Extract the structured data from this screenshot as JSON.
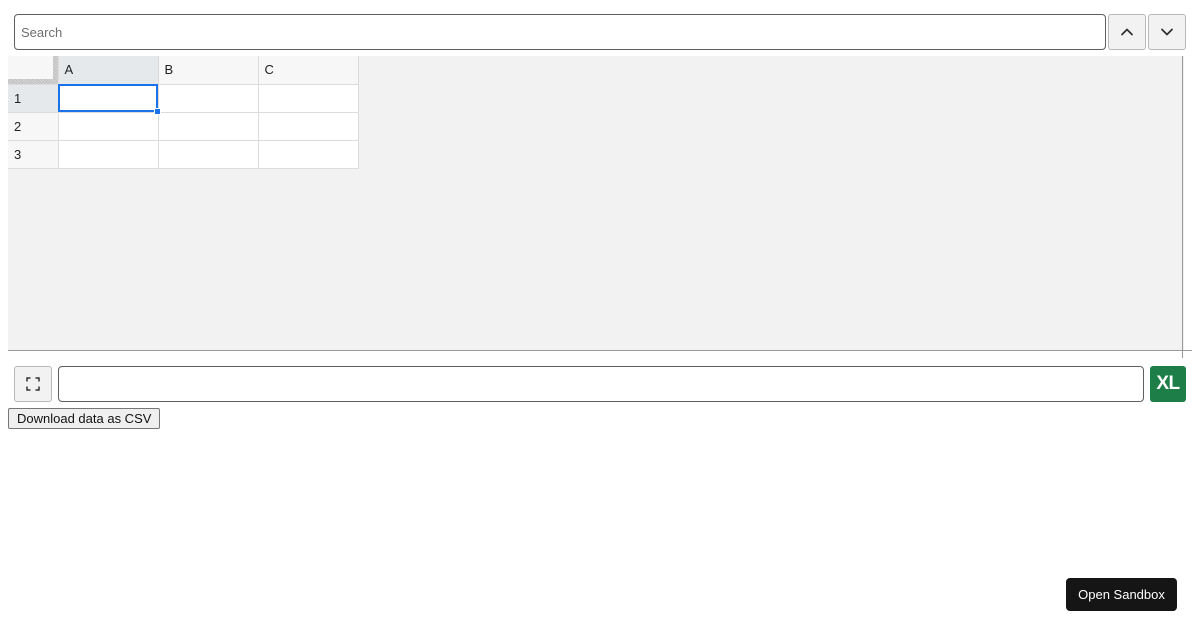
{
  "search": {
    "placeholder": "Search",
    "value": ""
  },
  "navigation": {
    "prev_icon": "chevron-up-icon",
    "next_icon": "chevron-down-icon"
  },
  "sheet": {
    "columns": [
      "A",
      "B",
      "C"
    ],
    "rows": [
      "1",
      "2",
      "3"
    ],
    "cells": [
      [
        "",
        "",
        ""
      ],
      [
        "",
        "",
        ""
      ],
      [
        "",
        "",
        ""
      ]
    ],
    "selected_cell": "A1"
  },
  "formula_bar": {
    "value": "",
    "fullscreen_icon": "fullscreen-icon",
    "badge_label": "XL",
    "badge_color": "#1d7f47"
  },
  "actions": {
    "download_csv_label": "Download data as CSV",
    "open_sandbox_label": "Open Sandbox"
  },
  "colors": {
    "selection": "#1a73e8",
    "sheet_background": "#f2f2f2",
    "sandbox_button": "#151515"
  }
}
